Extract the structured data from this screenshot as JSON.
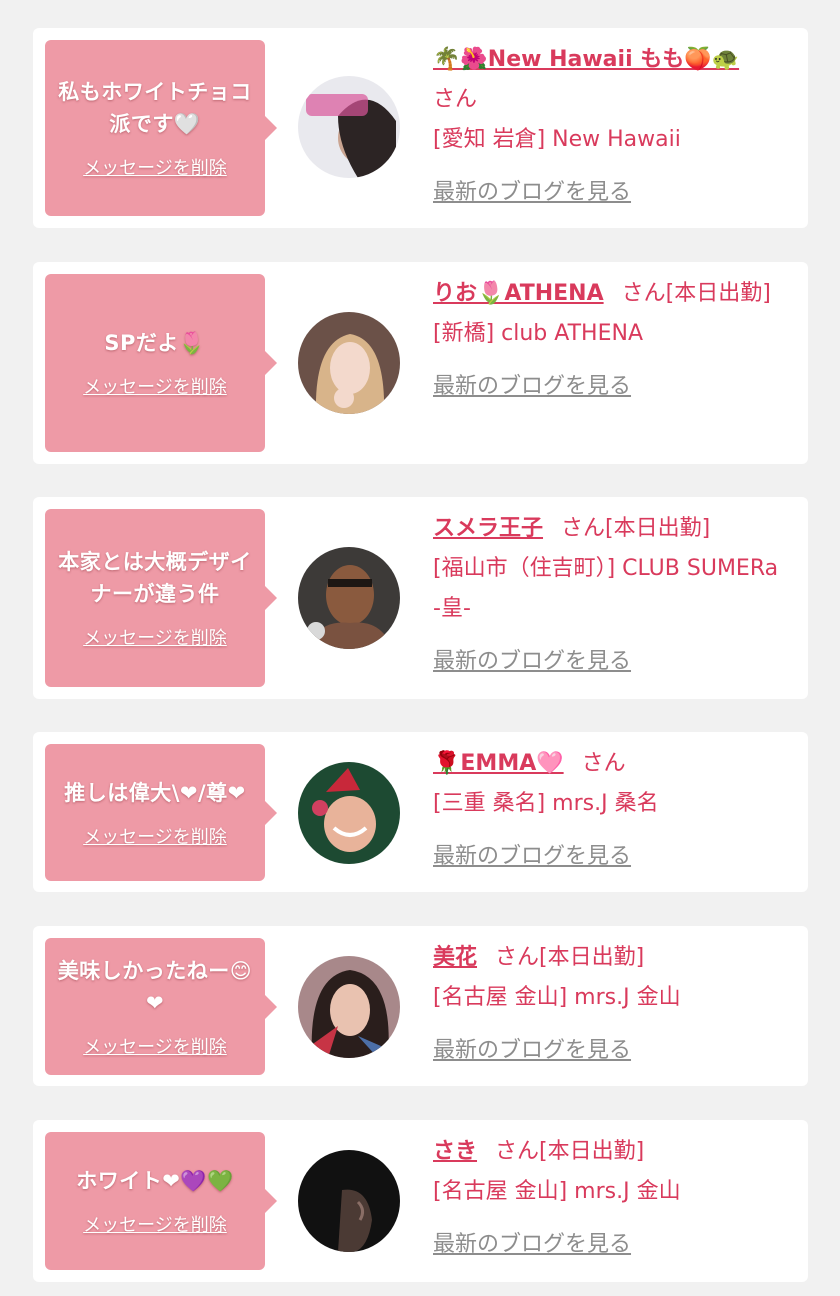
{
  "delete_label": "メッセージを削除",
  "blog_label": "最新のブログを見る",
  "cards": [
    {
      "message": "私もホワイトチョコ派です🤍",
      "name": "🌴🌺New Hawaii もも🍑🐢",
      "suffix": "さん",
      "shop": "[愛知 岩倉] New Hawaii"
    },
    {
      "message": "SPだよ🌷",
      "name": "りお🌷ATHENA",
      "suffix": "さん[本日出勤]",
      "shop": "[新橋] club ATHENA"
    },
    {
      "message": "本家とは大概デザイナーが違う件",
      "name": "スメラ王子",
      "suffix": "さん[本日出勤]",
      "shop": "[福山市（住吉町）] CLUB SUMERa -皇-"
    },
    {
      "message": "推しは偉大\\❤/尊❤",
      "name": "🌹EMMA🩷",
      "suffix": "さん",
      "shop": "[三重 桑名] mrs.J 桑名"
    },
    {
      "message": "美味しかったねー😊❤",
      "name": "美花",
      "suffix": "さん[本日出勤]",
      "shop": "[名古屋 金山] mrs.J 金山"
    },
    {
      "message": "ホワイト❤💜💚",
      "name": "さき",
      "suffix": "さん[本日出勤]",
      "shop": "[名古屋 金山] mrs.J 金山"
    }
  ],
  "colors": {
    "background": "#f1f1f1",
    "card": "#ffffff",
    "bubble": "#ee9aa6",
    "accent": "#d93a5c",
    "link_gray": "#8d8d8d"
  }
}
